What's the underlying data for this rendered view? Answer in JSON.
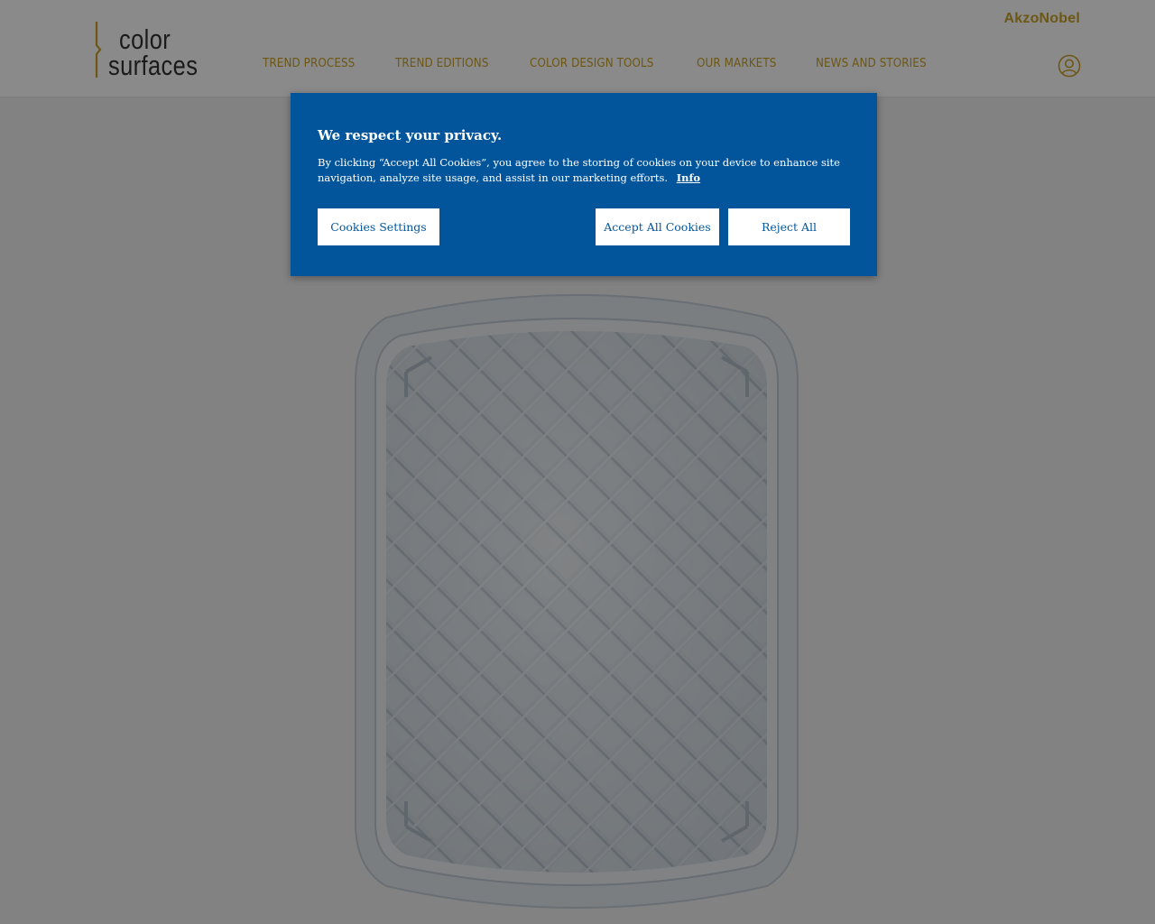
{
  "brand": {
    "logo_line1": "color",
    "logo_line2": "surfaces",
    "corporate": "AkzoNobel",
    "accent_color": "#c9a227"
  },
  "nav": {
    "items": [
      {
        "label": "TREND PROCESS"
      },
      {
        "label": "TREND EDITIONS"
      },
      {
        "label": "COLOR DESIGN TOOLS"
      },
      {
        "label": "OUR MARKETS"
      },
      {
        "label": "NEWS AND STORIES"
      }
    ],
    "account_icon": "user-circle-icon"
  },
  "main": {
    "image_subject": "rounded rectangular tray with diamond quilted pattern",
    "image_color": "#d4dde5"
  },
  "cookie_banner": {
    "title": "We respect your privacy.",
    "text": "By clicking “Accept All Cookies”, you agree to the storing of cookies on your device to enhance site navigation, analyze site usage, and assist in our marketing efforts.",
    "info_link": "Info",
    "settings_button": "Cookies Settings",
    "accept_button": "Accept All Cookies",
    "reject_button": "Reject All",
    "background_color": "#02559b"
  }
}
